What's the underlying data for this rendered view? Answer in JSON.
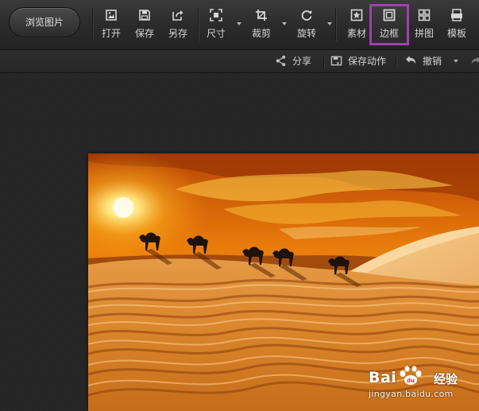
{
  "toolbar": {
    "browse_label": "浏览图片",
    "tools": [
      {
        "label": "打开",
        "icon": "open-image-icon"
      },
      {
        "label": "保存",
        "icon": "save-icon"
      },
      {
        "label": "另存",
        "icon": "save-as-icon"
      },
      {
        "label": "尺寸",
        "icon": "resize-icon"
      },
      {
        "label": "裁剪",
        "icon": "crop-icon"
      },
      {
        "label": "旋转",
        "icon": "rotate-icon"
      },
      {
        "label": "素材",
        "icon": "sticker-icon"
      },
      {
        "label": "边框",
        "icon": "frame-icon"
      },
      {
        "label": "拼图",
        "icon": "collage-icon"
      },
      {
        "label": "模板",
        "icon": "template-icon"
      }
    ],
    "highlight_color": "#a040b0"
  },
  "subbar": {
    "share_label": "分享",
    "save_action_label": "保存动作",
    "undo_label": "撤销"
  },
  "watermark": {
    "brand": "Bai",
    "suffix": "经验",
    "url": "jingyan.baidu.com"
  },
  "colors": {
    "toolbar_bg": "#2a2a2a",
    "canvas_bg": "#232323",
    "sky_orange": "#f08a10",
    "sand": "#e0963c"
  }
}
